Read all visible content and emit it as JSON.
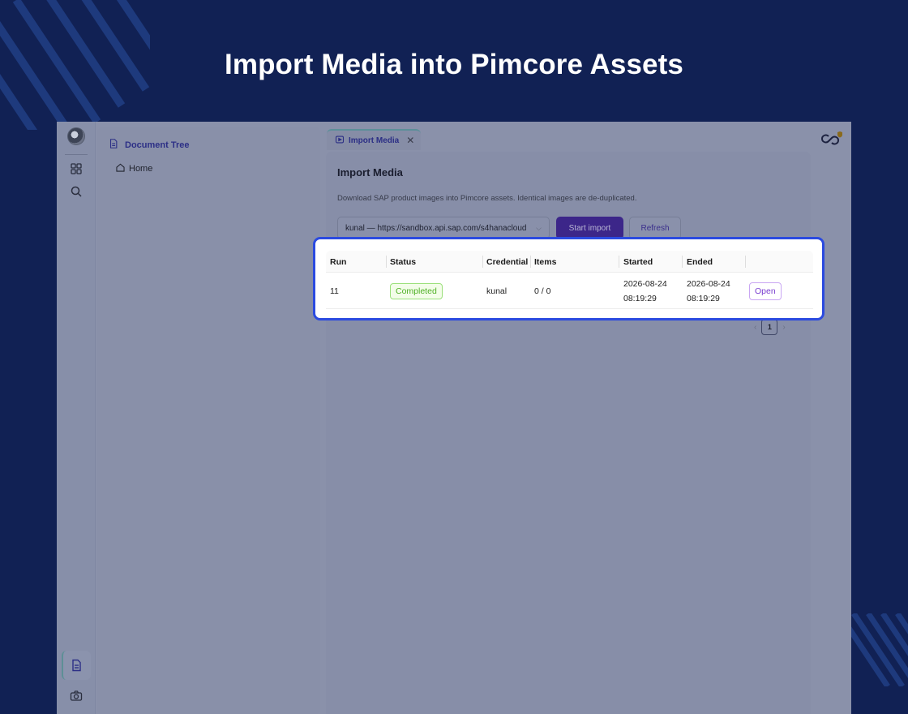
{
  "headline": "Import Media into Pimcore Assets",
  "colors": {
    "page_background": "#112154",
    "accent_purple": "#3c2689",
    "highlight_border": "#2b4ae0",
    "status_completed": "#4fb025"
  },
  "rail": {
    "icons": [
      "avatar",
      "grid-icon",
      "search-icon",
      "document-icon",
      "camera-icon"
    ]
  },
  "tree": {
    "title": "Document Tree",
    "items": [
      {
        "label": "Home",
        "icon": "home-icon"
      }
    ]
  },
  "tabs": [
    {
      "label": "Import Media",
      "icon": "play-icon"
    }
  ],
  "panel": {
    "title": "Import Media",
    "description": "Download SAP product images into Pimcore assets. Identical images are de-duplicated.",
    "credential_select": "kunal — https://sandbox.api.sap.com/s4hanacloud",
    "start_button": "Start import",
    "refresh_button": "Refresh"
  },
  "table": {
    "columns": [
      "Run",
      "Status",
      "Credential",
      "Items",
      "Started",
      "Ended"
    ],
    "rows": [
      {
        "run": "11",
        "status": "Completed",
        "credential": "kunal",
        "items": "0 / 0",
        "started_date": "2026-08-24",
        "started_time": "08:19:29",
        "ended_date": "2026-08-24",
        "ended_time": "08:19:29",
        "action": "Open"
      }
    ]
  },
  "pagination": {
    "current_page": "1"
  }
}
